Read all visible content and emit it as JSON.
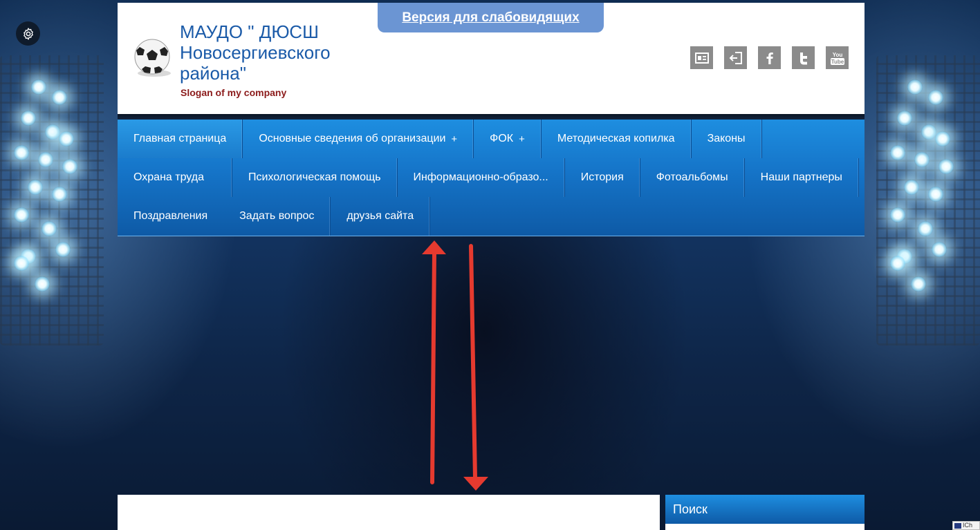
{
  "accessibility": {
    "version_link": "Версия для слабовидящих"
  },
  "header": {
    "title": "МАУДО \" ДЮСШ Новосергиевского района\"",
    "slogan": "Slogan of my company",
    "icons": [
      "contact-card-icon",
      "login-icon",
      "facebook-icon",
      "twitter-icon",
      "youtube-icon"
    ]
  },
  "nav": {
    "items": [
      {
        "label": "Главная страница",
        "has_submenu": false,
        "active": true
      },
      {
        "label": "Основные сведения об организации",
        "has_submenu": true
      },
      {
        "label": "ФОК",
        "has_submenu": true
      },
      {
        "label": "Методическая копилка",
        "has_submenu": false
      },
      {
        "label": "Законы",
        "has_submenu": false
      },
      {
        "label": "Охрана труда",
        "has_submenu": false
      },
      {
        "label": "Психологическая помощь",
        "has_submenu": false
      },
      {
        "label": "Информационно-образо...",
        "has_submenu": false
      },
      {
        "label": "История",
        "has_submenu": false
      },
      {
        "label": "Фотоальбомы",
        "has_submenu": false
      },
      {
        "label": "Наши партнеры",
        "has_submenu": false
      },
      {
        "label": "Поздравления",
        "has_submenu": false
      },
      {
        "label": "Задать вопрос",
        "has_submenu": false
      },
      {
        "label": "друзья сайта",
        "has_submenu": false
      }
    ],
    "plus_symbol": "+"
  },
  "sidebar": {
    "search_title": "Поиск"
  },
  "corner_badge": {
    "text": "ICh"
  },
  "colors": {
    "nav_blue": "#1574c8",
    "title_blue": "#1a5aa8",
    "slogan_red": "#8b1a1a",
    "a11y_tab": "#6b95d3",
    "annotation_arrow": "#e53a2f"
  }
}
